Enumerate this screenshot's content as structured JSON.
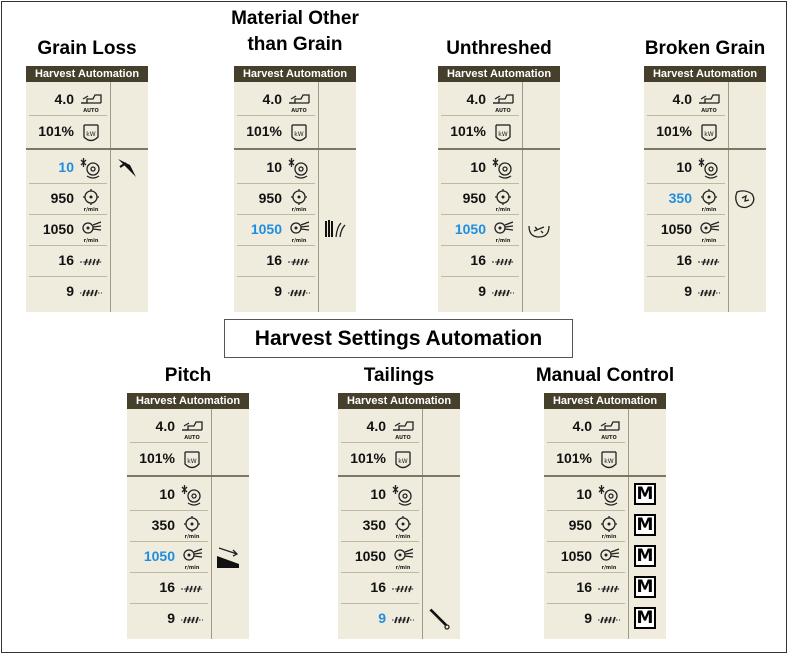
{
  "figure_title": "Harvest Settings Automation",
  "panel_header": "Harvest Automation",
  "icons": {
    "auto": "auto-header-icon",
    "engine": "engine-load-kw-icon",
    "concave": "concave-clearance-icon",
    "rotor": "rotor-speed-icon",
    "fan": "fan-speed-icon",
    "chaffer": "chaffer-opening-icon",
    "sieve": "sieve-opening-icon"
  },
  "highlight_color": "#1e8ee0",
  "panels": [
    {
      "title": "Grain Loss",
      "auto": "4.0",
      "engine": "101%",
      "concave": "10",
      "rotor": "950",
      "fan": "1050",
      "chaffer": "16",
      "sieve": "9",
      "side_icon": "grain-loss-icon",
      "highlight": "concave"
    },
    {
      "title": "Material Other than Grain",
      "auto": "4.0",
      "engine": "101%",
      "concave": "10",
      "rotor": "950",
      "fan": "1050",
      "chaffer": "16",
      "sieve": "9",
      "side_icon": "mog-icon",
      "highlight": "fan"
    },
    {
      "title": "Unthreshed",
      "auto": "4.0",
      "engine": "101%",
      "concave": "10",
      "rotor": "950",
      "fan": "1050",
      "chaffer": "16",
      "sieve": "9",
      "side_icon": "unthreshed-icon",
      "highlight": "fan"
    },
    {
      "title": "Broken Grain",
      "auto": "4.0",
      "engine": "101%",
      "concave": "10",
      "rotor": "350",
      "fan": "1050",
      "chaffer": "16",
      "sieve": "9",
      "side_icon": "broken-grain-icon",
      "highlight": "rotor"
    },
    {
      "title": "Pitch",
      "auto": "4.0",
      "engine": "101%",
      "concave": "10",
      "rotor": "350",
      "fan": "1050",
      "chaffer": "16",
      "sieve": "9",
      "side_icon": "pitch-icon",
      "highlight": "fan"
    },
    {
      "title": "Tailings",
      "auto": "4.0",
      "engine": "101%",
      "concave": "10",
      "rotor": "350",
      "fan": "1050",
      "chaffer": "16",
      "sieve": "9",
      "side_icon": "tailings-icon",
      "highlight": "sieve"
    },
    {
      "title": "Manual Control",
      "auto": "4.0",
      "engine": "101%",
      "concave": "10",
      "rotor": "950",
      "fan": "1050",
      "chaffer": "16",
      "sieve": "9",
      "side_icon": "manual-icon",
      "highlight": "",
      "manual_label": "M"
    }
  ]
}
